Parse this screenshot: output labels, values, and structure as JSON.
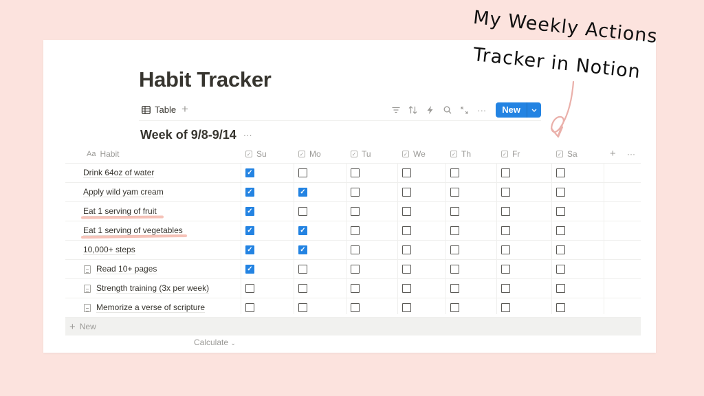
{
  "annotation": {
    "line1": "My Weekly Actions",
    "line2": "Tracker in Notion"
  },
  "page": {
    "title": "Habit Tracker"
  },
  "viewbar": {
    "view_label": "Table",
    "view_icon": "table-icon",
    "add_view": "+",
    "tools": [
      "filter-icon",
      "sort-icon",
      "automation-icon",
      "search-icon",
      "expand-icon",
      "more-icon"
    ],
    "new_label": "New",
    "accent": "#2383e2"
  },
  "group": {
    "title": "Week of 9/8-9/14",
    "more": "···"
  },
  "table": {
    "name_header": "Habit",
    "name_header_icon": "Aa",
    "day_headers": [
      "Su",
      "Mo",
      "Tu",
      "We",
      "Th",
      "Fr",
      "Sa"
    ],
    "add_column": "+",
    "more": "···",
    "rows": [
      {
        "name": "Drink 64oz of water",
        "page_icon": false,
        "checks": [
          true,
          false,
          false,
          false,
          false,
          false,
          false
        ]
      },
      {
        "name": "Apply wild yam cream",
        "page_icon": false,
        "checks": [
          true,
          true,
          false,
          false,
          false,
          false,
          false
        ]
      },
      {
        "name": "Eat 1 serving of fruit",
        "page_icon": false,
        "checks": [
          true,
          false,
          false,
          false,
          false,
          false,
          false
        ]
      },
      {
        "name": "Eat 1 serving of vegetables",
        "page_icon": false,
        "checks": [
          true,
          true,
          false,
          false,
          false,
          false,
          false
        ]
      },
      {
        "name": "10,000+ steps",
        "page_icon": false,
        "checks": [
          true,
          true,
          false,
          false,
          false,
          false,
          false
        ]
      },
      {
        "name": "Read 10+ pages",
        "page_icon": true,
        "checks": [
          true,
          false,
          false,
          false,
          false,
          false,
          false
        ]
      },
      {
        "name": "Strength training (3x per week)",
        "page_icon": true,
        "checks": [
          false,
          false,
          false,
          false,
          false,
          false,
          false
        ]
      },
      {
        "name": "Memorize a verse of scripture",
        "page_icon": true,
        "checks": [
          false,
          false,
          false,
          false,
          false,
          false,
          false
        ]
      }
    ],
    "new_row_label": "New",
    "calculate_label": "Calculate"
  }
}
